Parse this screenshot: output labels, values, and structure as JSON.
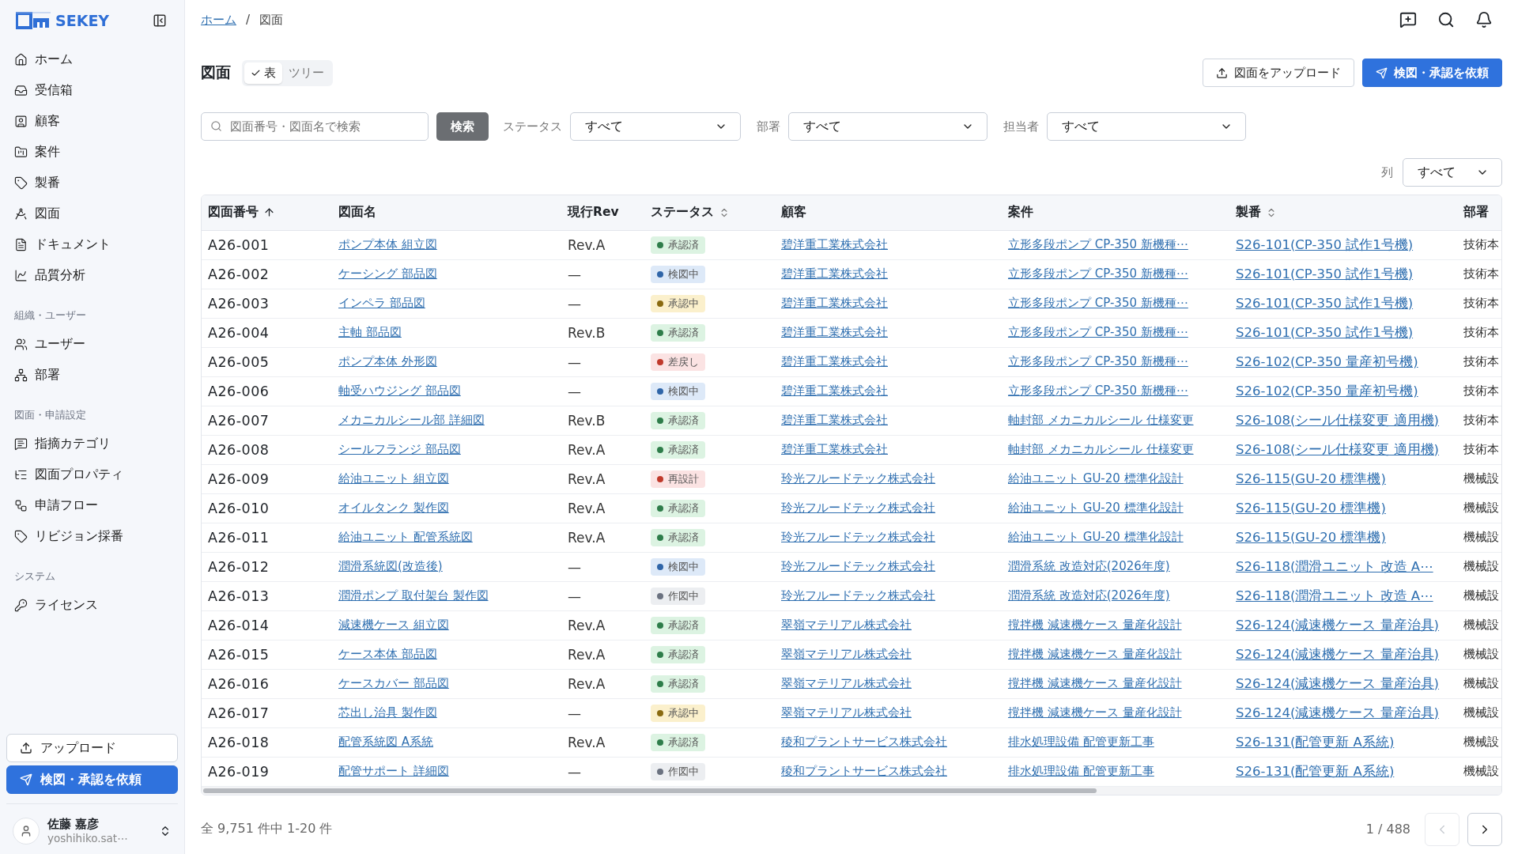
{
  "sidebar": {
    "logo": "SEKEY",
    "sections": [
      {
        "items": [
          {
            "label": "ホーム"
          },
          {
            "label": "受信箱"
          },
          {
            "label": "顧客"
          },
          {
            "label": "案件"
          },
          {
            "label": "製番"
          },
          {
            "label": "図面"
          },
          {
            "label": "ドキュメント"
          },
          {
            "label": "品質分析"
          }
        ]
      },
      {
        "heading": "組織・ユーザー",
        "items": [
          {
            "label": "ユーザー"
          },
          {
            "label": "部署"
          }
        ]
      },
      {
        "heading": "図面・申請設定",
        "items": [
          {
            "label": "指摘カテゴリ"
          },
          {
            "label": "図面プロパティ"
          },
          {
            "label": "申請フロー"
          },
          {
            "label": "リビジョン採番"
          }
        ]
      },
      {
        "heading": "システム",
        "items": [
          {
            "label": "ライセンス"
          }
        ]
      }
    ],
    "upload_button": "アップロード",
    "request_button": "検図・承認を依頼",
    "user": {
      "name": "佐藤 嘉彦",
      "email": "yoshihiko.sat⋯"
    }
  },
  "breadcrumb": {
    "items": [
      "ホーム",
      "図面"
    ],
    "separator": "/"
  },
  "page_title": "図面",
  "view_tabs": [
    {
      "label": "表",
      "selected": true
    },
    {
      "label": "ツリー",
      "selected": false
    }
  ],
  "actions": {
    "upload": "図面をアップロード",
    "request": "検図・承認を依頼"
  },
  "search": {
    "placeholder": "図面番号・図面名で検索",
    "button": "検索"
  },
  "filters": [
    {
      "label": "ステータス",
      "value": "すべて"
    },
    {
      "label": "部署",
      "value": "すべて"
    },
    {
      "label": "担当者",
      "value": "すべて"
    }
  ],
  "columns_filter": {
    "label": "列",
    "value": "すべて"
  },
  "table": {
    "columns": [
      {
        "label": "図面番号",
        "sorted_ascending": true
      },
      {
        "label": "図面名"
      },
      {
        "label": "現行Rev"
      },
      {
        "label": "ステータス",
        "sortable": true
      },
      {
        "label": "顧客"
      },
      {
        "label": "案件"
      },
      {
        "label": "製番",
        "sortable": true
      },
      {
        "label": "部署"
      }
    ],
    "rows": [
      {
        "id": "A26-001",
        "name": "ポンプ本体 組立図",
        "rev": "Rev.A",
        "status": {
          "label": "承認済",
          "kind": "approved"
        },
        "customer": "碧洋重工業株式会社",
        "project": "立形多段ポンプ CP-350 新機種⋯",
        "serial": "S26-101(CP-350 試作1号機)",
        "dept": "技術本"
      },
      {
        "id": "A26-002",
        "name": "ケーシング 部品図",
        "rev": "—",
        "status": {
          "label": "検図中",
          "kind": "checking"
        },
        "customer": "碧洋重工業株式会社",
        "project": "立形多段ポンプ CP-350 新機種⋯",
        "serial": "S26-101(CP-350 試作1号機)",
        "dept": "技術本"
      },
      {
        "id": "A26-003",
        "name": "インペラ 部品図",
        "rev": "—",
        "status": {
          "label": "承認中",
          "kind": "pending"
        },
        "customer": "碧洋重工業株式会社",
        "project": "立形多段ポンプ CP-350 新機種⋯",
        "serial": "S26-101(CP-350 試作1号機)",
        "dept": "技術本"
      },
      {
        "id": "A26-004",
        "name": "主軸 部品図",
        "rev": "Rev.B",
        "status": {
          "label": "承認済",
          "kind": "approved"
        },
        "customer": "碧洋重工業株式会社",
        "project": "立形多段ポンプ CP-350 新機種⋯",
        "serial": "S26-101(CP-350 試作1号機)",
        "dept": "技術本"
      },
      {
        "id": "A26-005",
        "name": "ポンプ本体 外形図",
        "rev": "—",
        "status": {
          "label": "差戻し",
          "kind": "rejected"
        },
        "customer": "碧洋重工業株式会社",
        "project": "立形多段ポンプ CP-350 新機種⋯",
        "serial": "S26-102(CP-350 量産初号機)",
        "dept": "技術本"
      },
      {
        "id": "A26-006",
        "name": "軸受ハウジング 部品図",
        "rev": "—",
        "status": {
          "label": "検図中",
          "kind": "checking"
        },
        "customer": "碧洋重工業株式会社",
        "project": "立形多段ポンプ CP-350 新機種⋯",
        "serial": "S26-102(CP-350 量産初号機)",
        "dept": "技術本"
      },
      {
        "id": "A26-007",
        "name": "メカニカルシール部 詳細図",
        "rev": "Rev.B",
        "status": {
          "label": "承認済",
          "kind": "approved"
        },
        "customer": "碧洋重工業株式会社",
        "project": "軸封部 メカニカルシール 仕様変更",
        "serial": "S26-108(シール仕様変更 適用機)",
        "dept": "技術本"
      },
      {
        "id": "A26-008",
        "name": "シールフランジ 部品図",
        "rev": "Rev.A",
        "status": {
          "label": "承認済",
          "kind": "approved"
        },
        "customer": "碧洋重工業株式会社",
        "project": "軸封部 メカニカルシール 仕様変更",
        "serial": "S26-108(シール仕様変更 適用機)",
        "dept": "技術本"
      },
      {
        "id": "A26-009",
        "name": "給油ユニット 組立図",
        "rev": "Rev.A",
        "status": {
          "label": "再設計",
          "kind": "rejected"
        },
        "customer": "玲光フルードテック株式会社",
        "project": "給油ユニット GU-20 標準化設計",
        "serial": "S26-115(GU-20 標準機)",
        "dept": "機械設"
      },
      {
        "id": "A26-010",
        "name": "オイルタンク 製作図",
        "rev": "Rev.A",
        "status": {
          "label": "承認済",
          "kind": "approved"
        },
        "customer": "玲光フルードテック株式会社",
        "project": "給油ユニット GU-20 標準化設計",
        "serial": "S26-115(GU-20 標準機)",
        "dept": "機械設"
      },
      {
        "id": "A26-011",
        "name": "給油ユニット 配管系統図",
        "rev": "Rev.A",
        "status": {
          "label": "承認済",
          "kind": "approved"
        },
        "customer": "玲光フルードテック株式会社",
        "project": "給油ユニット GU-20 標準化設計",
        "serial": "S26-115(GU-20 標準機)",
        "dept": "機械設"
      },
      {
        "id": "A26-012",
        "name": "潤滑系統図(改造後)",
        "rev": "—",
        "status": {
          "label": "検図中",
          "kind": "checking"
        },
        "customer": "玲光フルードテック株式会社",
        "project": "潤滑系統 改造対応(2026年度)",
        "serial": "S26-118(潤滑ユニット 改造 A⋯",
        "dept": "機械設"
      },
      {
        "id": "A26-013",
        "name": "潤滑ポンプ 取付架台 製作図",
        "rev": "—",
        "status": {
          "label": "作図中",
          "kind": "drafting"
        },
        "customer": "玲光フルードテック株式会社",
        "project": "潤滑系統 改造対応(2026年度)",
        "serial": "S26-118(潤滑ユニット 改造 A⋯",
        "dept": "機械設"
      },
      {
        "id": "A26-014",
        "name": "減速機ケース 組立図",
        "rev": "Rev.A",
        "status": {
          "label": "承認済",
          "kind": "approved"
        },
        "customer": "翠嶺マテリアル株式会社",
        "project": "撹拌機 減速機ケース 量産化設計",
        "serial": "S26-124(減速機ケース 量産治具)",
        "dept": "機械設"
      },
      {
        "id": "A26-015",
        "name": "ケース本体 部品図",
        "rev": "Rev.A",
        "status": {
          "label": "承認済",
          "kind": "approved"
        },
        "customer": "翠嶺マテリアル株式会社",
        "project": "撹拌機 減速機ケース 量産化設計",
        "serial": "S26-124(減速機ケース 量産治具)",
        "dept": "機械設"
      },
      {
        "id": "A26-016",
        "name": "ケースカバー 部品図",
        "rev": "Rev.A",
        "status": {
          "label": "承認済",
          "kind": "approved"
        },
        "customer": "翠嶺マテリアル株式会社",
        "project": "撹拌機 減速機ケース 量産化設計",
        "serial": "S26-124(減速機ケース 量産治具)",
        "dept": "機械設"
      },
      {
        "id": "A26-017",
        "name": "芯出し治具 製作図",
        "rev": "—",
        "status": {
          "label": "承認中",
          "kind": "pending"
        },
        "customer": "翠嶺マテリアル株式会社",
        "project": "撹拌機 減速機ケース 量産化設計",
        "serial": "S26-124(減速機ケース 量産治具)",
        "dept": "機械設"
      },
      {
        "id": "A26-018",
        "name": "配管系統図 A系統",
        "rev": "Rev.A",
        "status": {
          "label": "承認済",
          "kind": "approved"
        },
        "customer": "稜和プラントサービス株式会社",
        "project": "排水処理設備 配管更新工事",
        "serial": "S26-131(配管更新 A系統)",
        "dept": "機械設"
      },
      {
        "id": "A26-019",
        "name": "配管サポート 詳細図",
        "rev": "—",
        "status": {
          "label": "作図中",
          "kind": "drafting"
        },
        "customer": "稜和プラントサービス株式会社",
        "project": "排水処理設備 配管更新工事",
        "serial": "S26-131(配管更新 A系統)",
        "dept": "機械設"
      }
    ]
  },
  "pagination": {
    "summary": "全 9,751 件中 1-20 件",
    "page": "1 / 488",
    "prev_disabled": true,
    "next_disabled": false
  }
}
